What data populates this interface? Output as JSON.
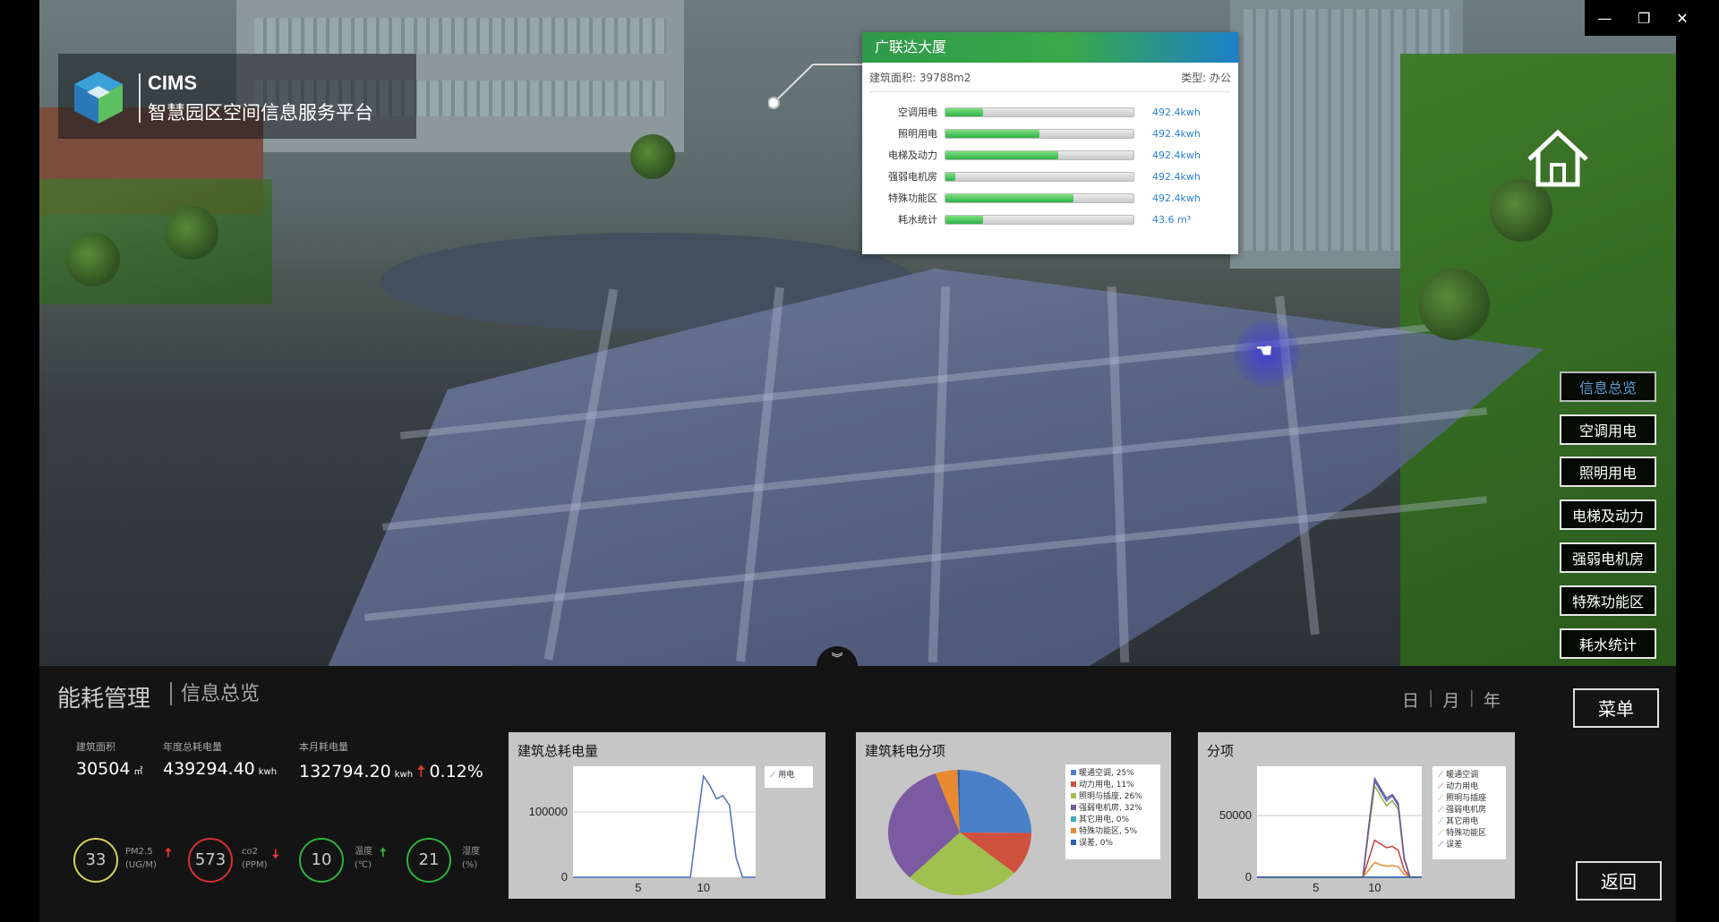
{
  "window_controls": {
    "minimize": "—",
    "restore": "❐",
    "close": "✕"
  },
  "logo": {
    "brand": "CIMS",
    "platform": "智慧园区空间信息服务平台",
    "icon": "cube-logo-icon"
  },
  "building_card": {
    "name": "广联达大厦",
    "area": "建筑面积: 39788m2",
    "type": "类型: 办公",
    "rows": [
      {
        "label": "空调用电",
        "value": "492.4kwh",
        "fill": 0.2
      },
      {
        "label": "照明用电",
        "value": "492.4kwh",
        "fill": 0.5
      },
      {
        "label": "电梯及动力",
        "value": "492.4kwh",
        "fill": 0.6
      },
      {
        "label": "强弱电机房",
        "value": "492.4kwh",
        "fill": 0.05
      },
      {
        "label": "特殊功能区",
        "value": "492.4kwh",
        "fill": 0.68
      },
      {
        "label": "耗水统计",
        "value": "43.6 m³",
        "fill": 0.2
      }
    ]
  },
  "home": {
    "icon": "home-icon"
  },
  "right_menu": [
    "信息总览",
    "空调用电",
    "照明用电",
    "电梯及动力",
    "强弱电机房",
    "特殊功能区",
    "耗水统计"
  ],
  "panel": {
    "title": "能耗管理",
    "subtitle": "信息总览",
    "periods": [
      "日",
      "月",
      "年"
    ],
    "menu_button": "菜单",
    "back_button": "返回",
    "collapse_icon": "chevron-double-down-icon",
    "stats": [
      {
        "key": "建筑面积",
        "value": "30504",
        "unit": "㎡"
      },
      {
        "key": "年度总耗电量",
        "value": "439294.40",
        "unit": "kwh"
      },
      {
        "key": "本月耗电量",
        "value": "132794.20",
        "unit": "kwh",
        "change": "0.12%"
      }
    ],
    "gauges": [
      {
        "value": "33",
        "label1": "PM2.5",
        "label2": "(UG/M)",
        "color": "#d8d060",
        "trend": "up",
        "trend_color": "#e03a2a"
      },
      {
        "value": "573",
        "label1": "co2",
        "label2": "(PPM)",
        "color": "#d83030",
        "trend": "down",
        "trend_color": "#e03a2a"
      },
      {
        "value": "10",
        "label1": "温度",
        "label2": "(℃)",
        "color": "#30b040",
        "trend": "up",
        "trend_color": "#30b040"
      },
      {
        "value": "21",
        "label1": "湿度",
        "label2": "(%)",
        "color": "#30b040",
        "trend": "",
        "trend_color": ""
      }
    ]
  },
  "chart_data": [
    {
      "type": "line",
      "title": "建筑总耗电量",
      "x": [
        0,
        1,
        2,
        3,
        4,
        5,
        6,
        7,
        8,
        9,
        9.5,
        10,
        10.5,
        11,
        11.5,
        12,
        12.5,
        13,
        14
      ],
      "series": [
        {
          "name": "用电",
          "values": [
            0,
            0,
            0,
            0,
            0,
            0,
            0,
            0,
            0,
            0,
            80000,
            155000,
            140000,
            120000,
            125000,
            110000,
            30000,
            0,
            0
          ]
        }
      ],
      "xticks": [
        "5",
        "10"
      ],
      "yticks": [
        "0",
        "100000"
      ],
      "ylim": [
        0,
        170000
      ],
      "legend": "top-right"
    },
    {
      "type": "pie",
      "title": "建筑耗电分项",
      "slices": [
        {
          "label": "暖通空调, 25%",
          "value": 25,
          "color": "#4a80c8"
        },
        {
          "label": "动力用电, 11%",
          "value": 11,
          "color": "#d05040"
        },
        {
          "label": "照明与插座, 26%",
          "value": 26,
          "color": "#a0c050"
        },
        {
          "label": "强弱电机房, 32%",
          "value": 32,
          "color": "#7a5aa0"
        },
        {
          "label": "其它用电, 0%",
          "value": 0,
          "color": "#40a8c8"
        },
        {
          "label": "特殊功能区, 5%",
          "value": 5,
          "color": "#e88a30"
        },
        {
          "label": "误差, 0%",
          "value": 0.5,
          "color": "#2a60b0"
        }
      ],
      "legend": "right"
    },
    {
      "type": "line",
      "title": "分项",
      "x": [
        0,
        1,
        2,
        3,
        4,
        5,
        6,
        7,
        8,
        9,
        9.5,
        10,
        10.5,
        11,
        11.5,
        12,
        12.5,
        13,
        14
      ],
      "series": [
        {
          "name": "暖通空调",
          "color": "#4a70c0",
          "values": [
            0,
            0,
            0,
            0,
            0,
            0,
            0,
            0,
            0,
            0,
            40000,
            78000,
            70000,
            62000,
            66000,
            58000,
            15000,
            0,
            0
          ]
        },
        {
          "name": "动力用电",
          "color": "#c84040",
          "values": [
            0,
            0,
            0,
            0,
            0,
            0,
            0,
            0,
            0,
            0,
            15000,
            30000,
            27000,
            24000,
            25000,
            22000,
            6000,
            0,
            0
          ]
        },
        {
          "name": "照明与插座",
          "color": "#90b040",
          "values": [
            0,
            0,
            0,
            0,
            0,
            0,
            0,
            0,
            0,
            0,
            38000,
            74000,
            66000,
            58000,
            62000,
            55000,
            14000,
            0,
            0
          ]
        },
        {
          "name": "强弱电机房",
          "color": "#7050a0",
          "values": [
            0,
            0,
            0,
            0,
            0,
            0,
            0,
            0,
            0,
            0,
            42000,
            80000,
            72000,
            64000,
            67000,
            60000,
            16000,
            0,
            0
          ]
        },
        {
          "name": "其它用电",
          "color": "#40a8c8",
          "values": [
            0,
            0,
            0,
            0,
            0,
            0,
            0,
            0,
            0,
            0,
            0,
            0,
            0,
            0,
            0,
            0,
            0,
            0,
            0
          ]
        },
        {
          "name": "特殊功能区",
          "color": "#e88a30",
          "values": [
            0,
            0,
            0,
            0,
            0,
            0,
            0,
            0,
            0,
            0,
            6000,
            12000,
            10000,
            9000,
            9500,
            8500,
            2500,
            0,
            0
          ]
        },
        {
          "name": "误差",
          "color": "#2a60b0",
          "values": [
            0,
            0,
            0,
            0,
            0,
            0,
            0,
            0,
            0,
            0,
            0,
            0,
            0,
            0,
            0,
            0,
            0,
            0,
            0
          ]
        }
      ],
      "xticks": [
        "5",
        "10"
      ],
      "yticks": [
        "0",
        "50000"
      ],
      "ylim": [
        0,
        90000
      ],
      "legend": "top-right"
    }
  ]
}
